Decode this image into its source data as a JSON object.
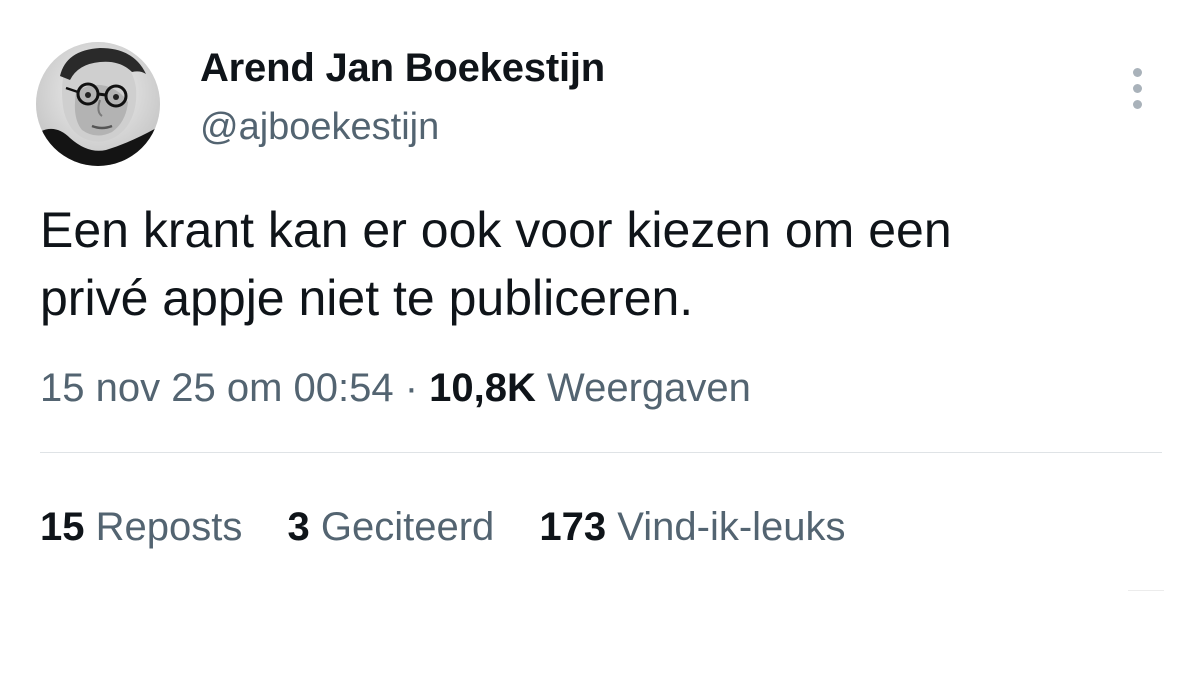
{
  "author": {
    "name": "Arend Jan Boekestijn",
    "handle": "@ajboekestijn"
  },
  "tweet": {
    "text_line1": "Een krant kan er ook voor kiezen om een",
    "text_line2": "privé appje niet te publiceren."
  },
  "meta": {
    "date": "15 nov 25 om 00:54",
    "separator": "·",
    "views_count": "10,8K",
    "views_label": "Weergaven"
  },
  "stats": {
    "reposts_count": "15",
    "reposts_label": "Reposts",
    "quotes_count": "3",
    "quotes_label": "Geciteerd",
    "likes_count": "173",
    "likes_label": "Vind-ik-leuks"
  },
  "icons": {
    "more": "more-vertical-icon"
  },
  "colors": {
    "text_primary": "#0f1419",
    "text_secondary": "#536471",
    "divider": "#dfe3e6",
    "background": "#ffffff"
  }
}
